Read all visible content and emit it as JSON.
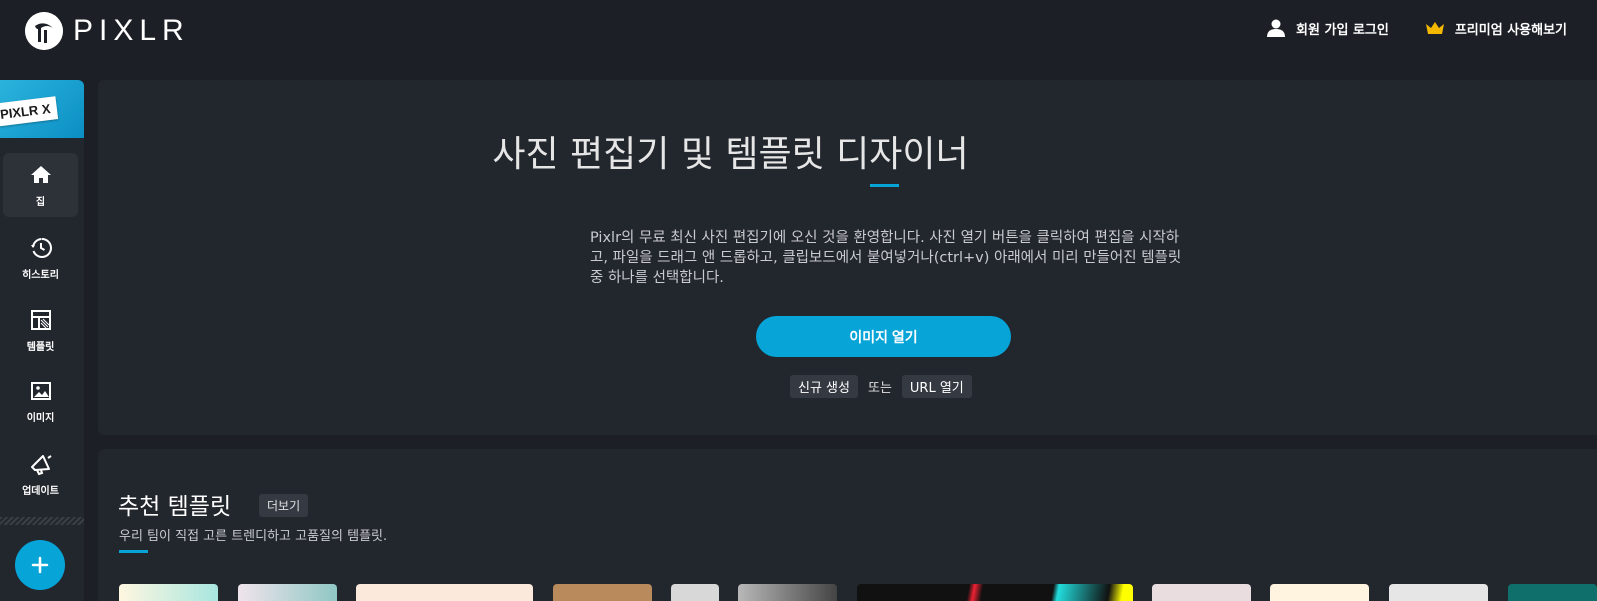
{
  "app": {
    "brand": "PIXLR"
  },
  "header": {
    "login_label": "회원 가입 로그인",
    "premium_label": "프리미엄 사용해보기"
  },
  "sidebar": {
    "promo_label": "PIXLR X",
    "items": [
      {
        "label": "집",
        "icon": "home-icon"
      },
      {
        "label": "히스토리",
        "icon": "history-icon"
      },
      {
        "label": "템플릿",
        "icon": "template-icon"
      },
      {
        "label": "이미지",
        "icon": "image-icon"
      },
      {
        "label": "업데이트",
        "icon": "megaphone-icon"
      }
    ],
    "add_icon": "plus-icon"
  },
  "hero": {
    "title": "사진 편집기 및 템플릿 디자이너",
    "description": "Pixlr의 무료 최신 사진 편집기에 오신 것을 환영합니다. 사진 열기 버튼을 클릭하여 편집을 시작하고, 파일을 드래그 앤 드롭하고, 클립보드에서 붙여넣거나(ctrl+v) 아래에서 미리 만들어진 템플릿 중 하나를 선택합니다.",
    "open_button": "이미지 열기",
    "new_label": "신규 생성",
    "or_label": "또는",
    "url_label": "URL 열기"
  },
  "templates": {
    "title": "추천 템플릿",
    "more_label": "더보기",
    "subtitle": "우리 팀이 직접 고른 트렌디하고 고품질의 템플릿."
  },
  "colors": {
    "accent": "#07a4d8",
    "background": "#1c1f25",
    "panel": "#22262d",
    "premium_crown": "#f5b800"
  }
}
